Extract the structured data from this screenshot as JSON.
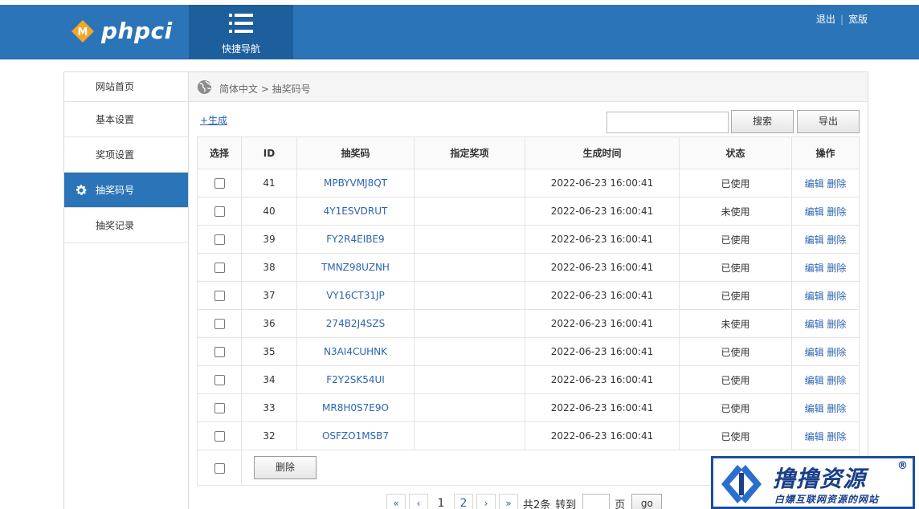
{
  "header": {
    "logo_text": "phpci",
    "logo_letter": "M",
    "quicknav_label": "快捷导航",
    "links": [
      "退出",
      "宽版"
    ],
    "separator": "|",
    "colors": {
      "bar": "#2b74b8",
      "quicknav": "#1d5f9d",
      "logo_diamond": "#f5a623"
    }
  },
  "sidebar": {
    "items": [
      {
        "label": "网站首页",
        "active": false
      },
      {
        "label": "基本设置",
        "active": false
      },
      {
        "label": "奖项设置",
        "active": false
      },
      {
        "label": "抽奖码号",
        "active": true,
        "icon": "gear-icon"
      },
      {
        "label": "抽奖记录",
        "active": false
      }
    ]
  },
  "breadcrumb": {
    "text": "简体中文 > 抽奖码号",
    "icon": "globe-icon"
  },
  "toolbar": {
    "generate_link": "+生成",
    "search_placeholder": "",
    "search_button": "搜索",
    "export_button": "导出"
  },
  "table": {
    "headers": [
      "选择",
      "ID",
      "抽奖码",
      "指定奖项",
      "生成时间",
      "状态",
      "操作"
    ],
    "rows": [
      {
        "id": "41",
        "code": "MPBYVMJ8QT",
        "prize": "",
        "time": "2022-06-23 16:00:41",
        "status": "已使用"
      },
      {
        "id": "40",
        "code": "4Y1ESVDRUT",
        "prize": "",
        "time": "2022-06-23 16:00:41",
        "status": "未使用"
      },
      {
        "id": "39",
        "code": "FY2R4EIBE9",
        "prize": "",
        "time": "2022-06-23 16:00:41",
        "status": "已使用"
      },
      {
        "id": "38",
        "code": "TMNZ98UZNH",
        "prize": "",
        "time": "2022-06-23 16:00:41",
        "status": "已使用"
      },
      {
        "id": "37",
        "code": "VY16CT31JP",
        "prize": "",
        "time": "2022-06-23 16:00:41",
        "status": "已使用"
      },
      {
        "id": "36",
        "code": "274B2J4SZS",
        "prize": "",
        "time": "2022-06-23 16:00:41",
        "status": "未使用"
      },
      {
        "id": "35",
        "code": "N3AI4CUHNK",
        "prize": "",
        "time": "2022-06-23 16:00:41",
        "status": "已使用"
      },
      {
        "id": "34",
        "code": "F2Y2SK54UI",
        "prize": "",
        "time": "2022-06-23 16:00:41",
        "status": "已使用"
      },
      {
        "id": "33",
        "code": "MR8H0S7E9O",
        "prize": "",
        "time": "2022-06-23 16:00:41",
        "status": "已使用"
      },
      {
        "id": "32",
        "code": "OSFZO1MSB7",
        "prize": "",
        "time": "2022-06-23 16:00:41",
        "status": "已使用"
      }
    ],
    "edit_label": "编辑",
    "delete_label": "删除",
    "bulk_delete_button": "删除"
  },
  "pagination": {
    "first": "«",
    "prev": "‹",
    "pages": [
      "1",
      "2"
    ],
    "current": "2",
    "next": "›",
    "last": "»",
    "total_text": "共2条",
    "goto_text": "转到",
    "page_unit": "页",
    "go_button": "go"
  },
  "watermark": {
    "title": "撸撸资源",
    "registered": "®",
    "subtitle": "白嫖互联网资源的网站"
  }
}
